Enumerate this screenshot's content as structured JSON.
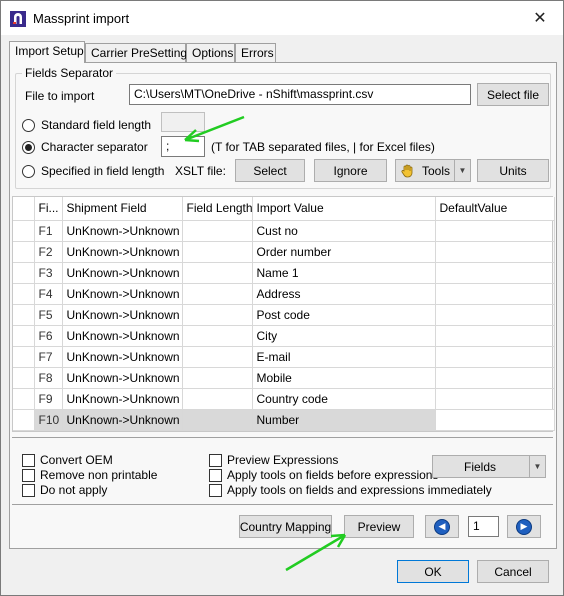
{
  "window": {
    "title": "Massprint import",
    "close_glyph": "✕"
  },
  "tabs": [
    "Import Setup",
    "Carrier PreSettings",
    "Options",
    "Errors"
  ],
  "fields_separator": {
    "group_label": "Fields Separator",
    "file_label": "File to import",
    "file_value": "C:\\Users\\MT\\OneDrive - nShift\\massprint.csv",
    "select_file": "Select file",
    "standard_label": "Standard field length",
    "character_label": "Character separator",
    "character_value": ";",
    "character_hint": "(T for TAB separated files, | for Excel files)",
    "specified_label": "Specified in field length",
    "xslt_label": "XSLT file:",
    "select_btn": "Select",
    "ignore_btn": "Ignore",
    "tools_btn": "Tools",
    "units_btn": "Units"
  },
  "table": {
    "headers": [
      "Fi...",
      "Shipment Field",
      "Field Length",
      "Import Value",
      "DefaultValue"
    ],
    "rows": [
      {
        "f": "F1",
        "shipment": "UnKnown->Unknown",
        "length": "",
        "import": "Cust no",
        "default": ""
      },
      {
        "f": "F2",
        "shipment": "UnKnown->Unknown",
        "length": "",
        "import": "Order number",
        "default": ""
      },
      {
        "f": "F3",
        "shipment": "UnKnown->Unknown",
        "length": "",
        "import": "Name 1",
        "default": ""
      },
      {
        "f": "F4",
        "shipment": "UnKnown->Unknown",
        "length": "",
        "import": "Address",
        "default": ""
      },
      {
        "f": "F5",
        "shipment": "UnKnown->Unknown",
        "length": "",
        "import": "Post code",
        "default": ""
      },
      {
        "f": "F6",
        "shipment": "UnKnown->Unknown",
        "length": "",
        "import": "City",
        "default": ""
      },
      {
        "f": "F7",
        "shipment": "UnKnown->Unknown",
        "length": "",
        "import": "E-mail",
        "default": ""
      },
      {
        "f": "F8",
        "shipment": "UnKnown->Unknown",
        "length": "",
        "import": "Mobile",
        "default": ""
      },
      {
        "f": "F9",
        "shipment": "UnKnown->Unknown",
        "length": "",
        "import": "Country code",
        "default": ""
      },
      {
        "f": "F10",
        "shipment": "UnKnown->Unknown",
        "length": "",
        "import": "Number",
        "default": ""
      }
    ]
  },
  "options": {
    "convert_oem": "Convert OEM",
    "remove_non_printable": "Remove non printable",
    "do_not_apply": "Do not apply",
    "preview_expressions": "Preview Expressions",
    "apply_before": "Apply tools on fields before expressions",
    "apply_immediately": "Apply tools on fields and expressions immediately",
    "fields_btn": "Fields"
  },
  "bottom": {
    "country_mapping": "Country Mapping",
    "preview": "Preview",
    "page_value": "1"
  },
  "dialog": {
    "ok": "OK",
    "cancel": "Cancel"
  },
  "colors": {
    "annotation_arrow": "#22cc22",
    "selected_row": "#d9d9d9",
    "nav_blue": "#1f5fbf"
  }
}
